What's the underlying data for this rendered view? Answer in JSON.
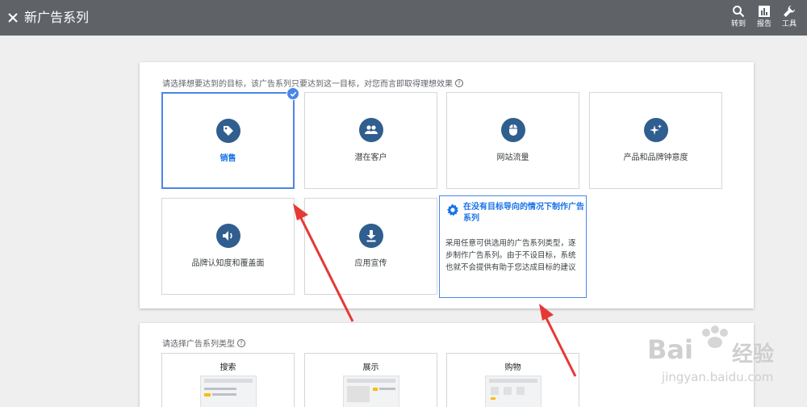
{
  "header": {
    "title": "新广告系列",
    "tools": [
      {
        "label": "转到",
        "icon": "search-icon"
      },
      {
        "label": "报告",
        "icon": "bar-chart-icon"
      },
      {
        "label": "工具",
        "icon": "wrench-icon"
      }
    ]
  },
  "goals": {
    "prompt": "请选择想要达到的目标，该广告系列只要达到这一目标，对您而言即取得理想效果",
    "tiles": [
      {
        "label": "销售",
        "icon": "tag-icon",
        "selected": true
      },
      {
        "label": "潜在客户",
        "icon": "people-icon"
      },
      {
        "label": "网站流量",
        "icon": "mouse-icon"
      },
      {
        "label": "产品和品牌钟意度",
        "icon": "sparkle-icon"
      },
      {
        "label": "品牌认知度和覆盖面",
        "icon": "speaker-icon"
      },
      {
        "label": "应用宣传",
        "icon": "download-icon"
      }
    ],
    "no_goal": {
      "title": "在没有目标导向的情况下制作广告系列",
      "description": "采用任意可供选用的广告系列类型，逐步制作广告系列。由于不设目标，系统也就不会提供有助于您达成目标的建议"
    }
  },
  "campaign_types": {
    "prompt": "请选择广告系列类型",
    "tiles": [
      {
        "label": "搜索"
      },
      {
        "label": "展示"
      },
      {
        "label": "购物"
      }
    ]
  },
  "watermark": {
    "text": "Bai",
    "text2": "经验",
    "url": "jingyan.baidu.com"
  },
  "colors": {
    "accent": "#4a86e8",
    "icon_bg": "#2f5e8f",
    "topbar": "#5f6368",
    "arrow": "#e53935"
  }
}
